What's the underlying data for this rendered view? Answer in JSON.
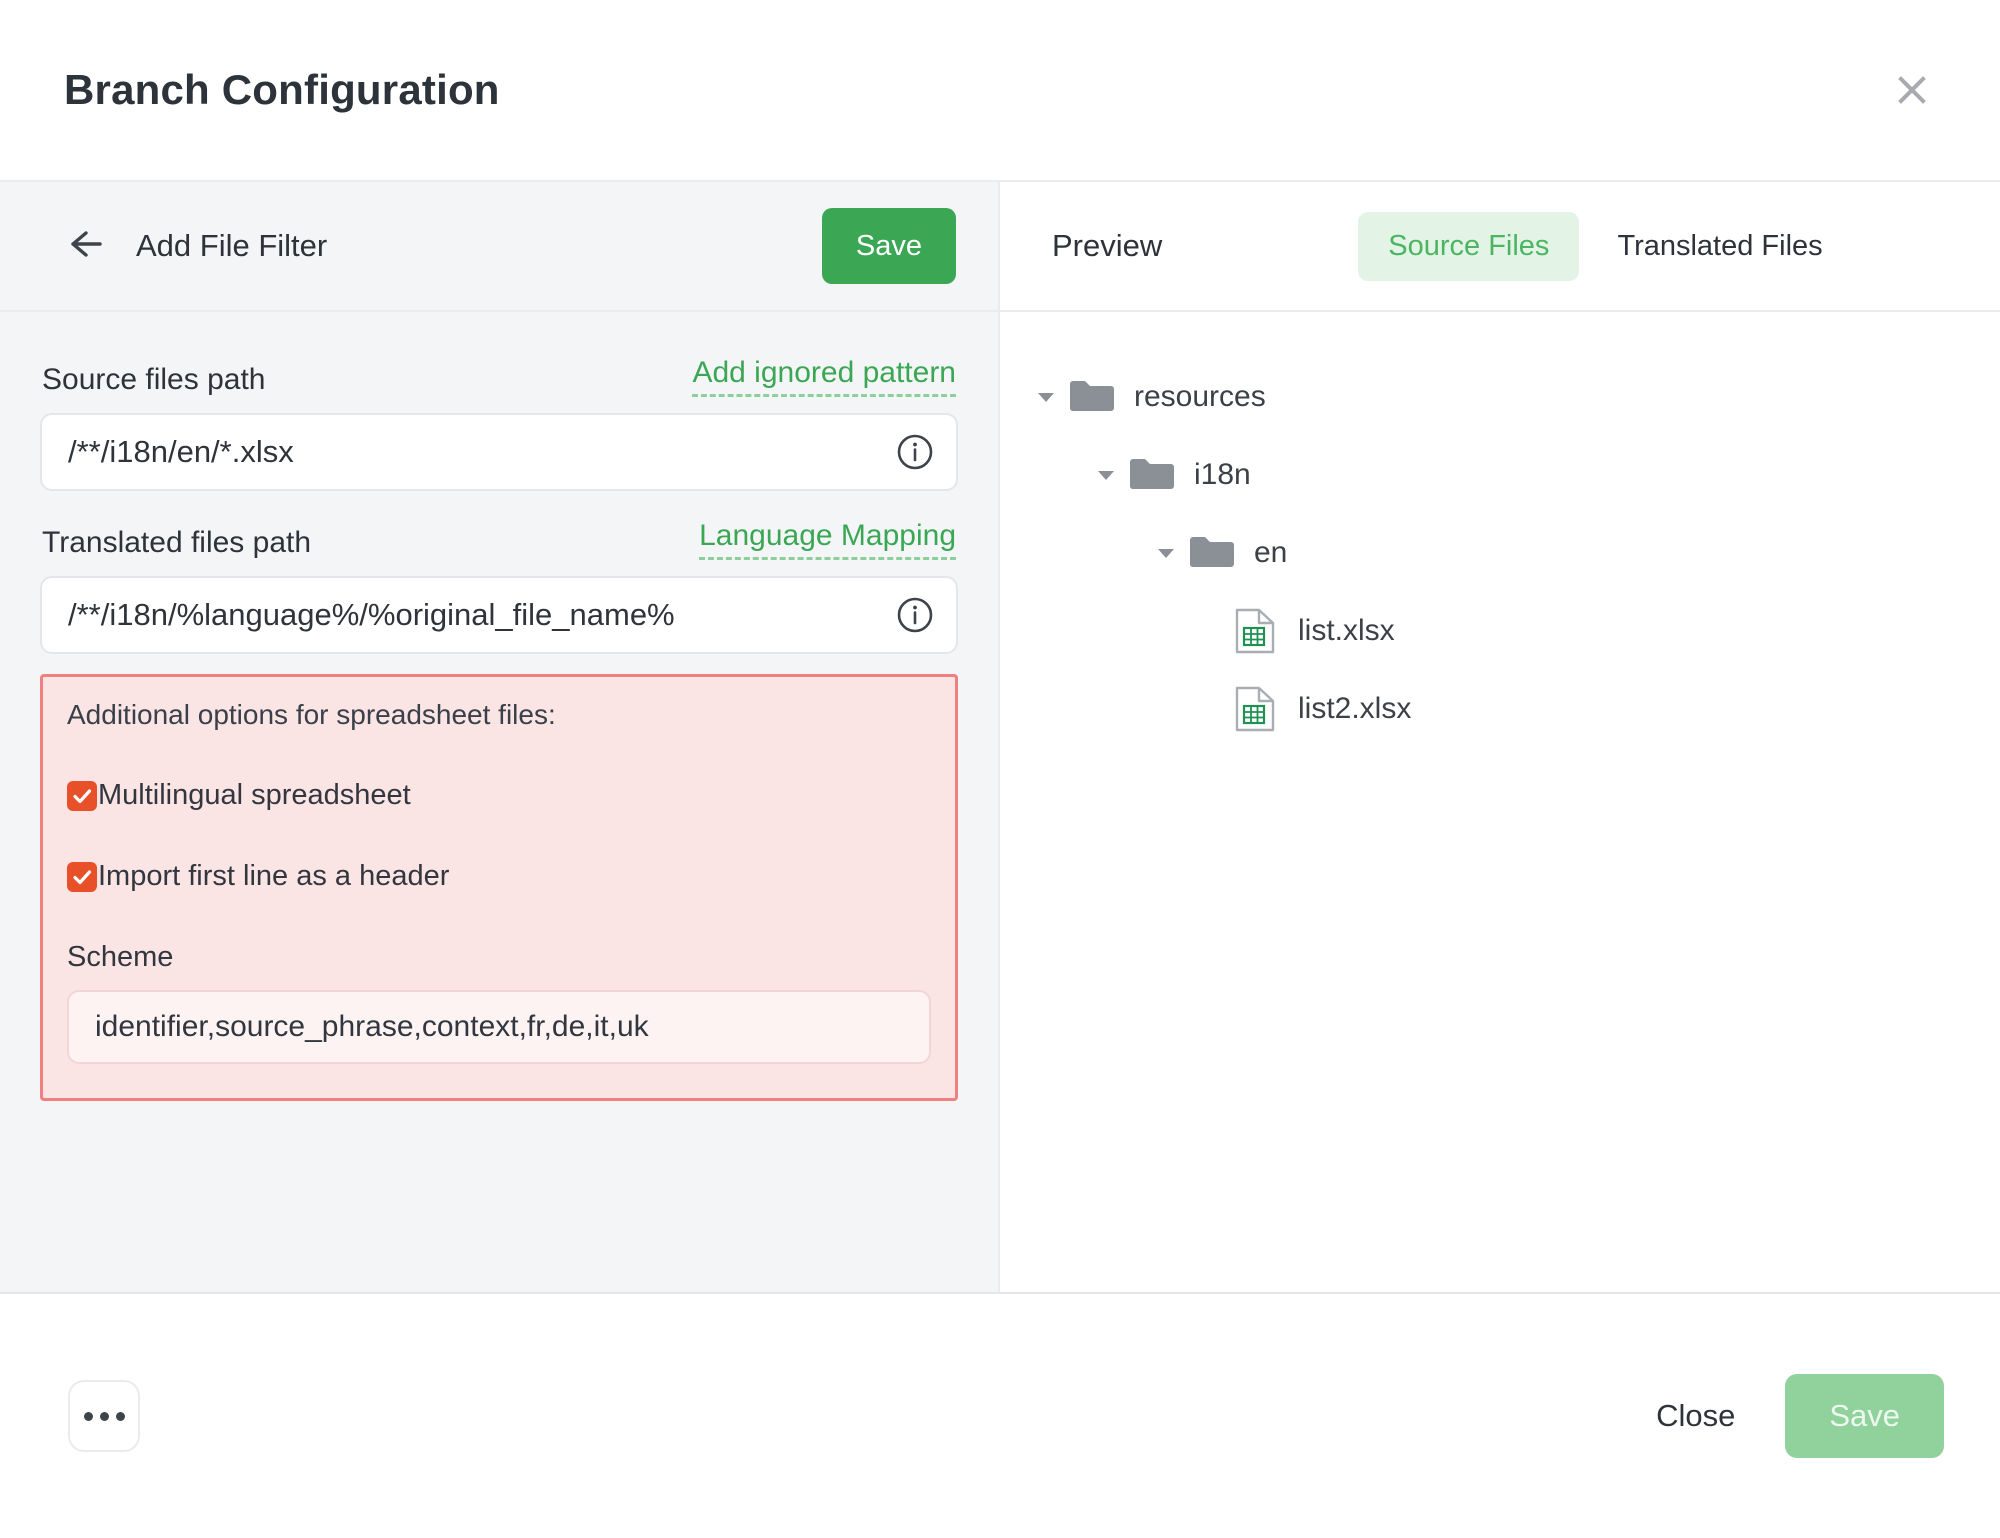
{
  "dialog": {
    "title": "Branch Configuration",
    "close_icon": "close-icon"
  },
  "left_panel": {
    "back_icon": "arrow-left-icon",
    "subtitle": "Add File Filter",
    "save_label": "Save",
    "source_files": {
      "label": "Source files path",
      "link_label": "Add ignored pattern",
      "value": "/**/i18n/en/*.xlsx",
      "info_icon": "info-icon"
    },
    "translated_files": {
      "label": "Translated files path",
      "link_label": "Language Mapping",
      "value": "/**/i18n/%language%/%original_file_name%",
      "info_icon": "info-icon"
    },
    "spreadsheet_options": {
      "title": "Additional options for spreadsheet files:",
      "checkboxes": [
        {
          "label": "Multilingual spreadsheet",
          "checked": true
        },
        {
          "label": "Import first line as a header",
          "checked": true
        }
      ],
      "scheme_label": "Scheme",
      "scheme_value": "identifier,source_phrase,context,fr,de,it,uk",
      "highlight_border_color": "#f08080",
      "highlight_bg_color": "#fbe4e4",
      "checkbox_color": "#e8502a"
    }
  },
  "right_panel": {
    "preview_label": "Preview",
    "tabs": [
      {
        "label": "Source Files",
        "active": true
      },
      {
        "label": "Translated Files",
        "active": false
      }
    ],
    "tree": [
      {
        "label": "resources",
        "type": "folder",
        "depth": 1,
        "expanded": true
      },
      {
        "label": "i18n",
        "type": "folder",
        "depth": 2,
        "expanded": true
      },
      {
        "label": "en",
        "type": "folder",
        "depth": 3,
        "expanded": true
      },
      {
        "label": "list.xlsx",
        "type": "xlsx-file",
        "depth": 4,
        "expanded": false
      },
      {
        "label": "list2.xlsx",
        "type": "xlsx-file",
        "depth": 4,
        "expanded": false
      }
    ]
  },
  "footer": {
    "more_icon": "ellipsis-icon",
    "close_label": "Close",
    "save_label": "Save",
    "save_disabled": true
  },
  "colors": {
    "accent_green": "#3ba755",
    "tab_active_text": "#4cb563",
    "tab_active_bg": "#e3f4e6",
    "panel_bg": "#f4f5f7",
    "save_disabled": "#90d19c",
    "folder_icon": "#8b9096",
    "xlsx_icon": "#1e9153"
  }
}
